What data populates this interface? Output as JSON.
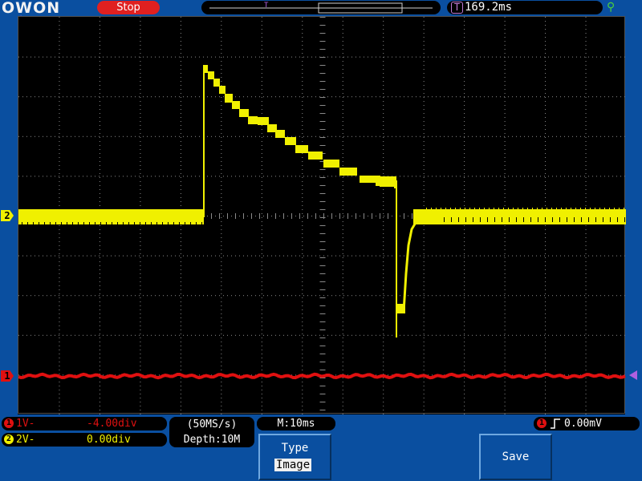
{
  "topbar": {
    "brand": "OWON",
    "run_state": "Stop",
    "trigger_position": "169.2ms",
    "trigger_icon": "T",
    "usb_icon": "usb-icon"
  },
  "channels": {
    "ch1": {
      "marker": "1",
      "color": "#e01010",
      "volts": "1V-",
      "offset": "-4.00div"
    },
    "ch2": {
      "marker": "2",
      "color": "#f0f000",
      "volts": "2V-",
      "offset": "0.00div"
    }
  },
  "acquisition": {
    "sample_rate": "(50MS/s)",
    "depth": "Depth:10M",
    "timebase": "M:10ms"
  },
  "trigger": {
    "source": "1",
    "value": "0.00mV"
  },
  "softkeys": {
    "type_label": "Type",
    "type_value": "Image",
    "save_label": "Save"
  },
  "colors": {
    "frame_blue": "#0a4fa0",
    "stop_red": "#e02020",
    "trace_yellow": "#f0f000",
    "trace_red": "#e01010",
    "trigger_marker_purple": "#b060e0"
  }
}
